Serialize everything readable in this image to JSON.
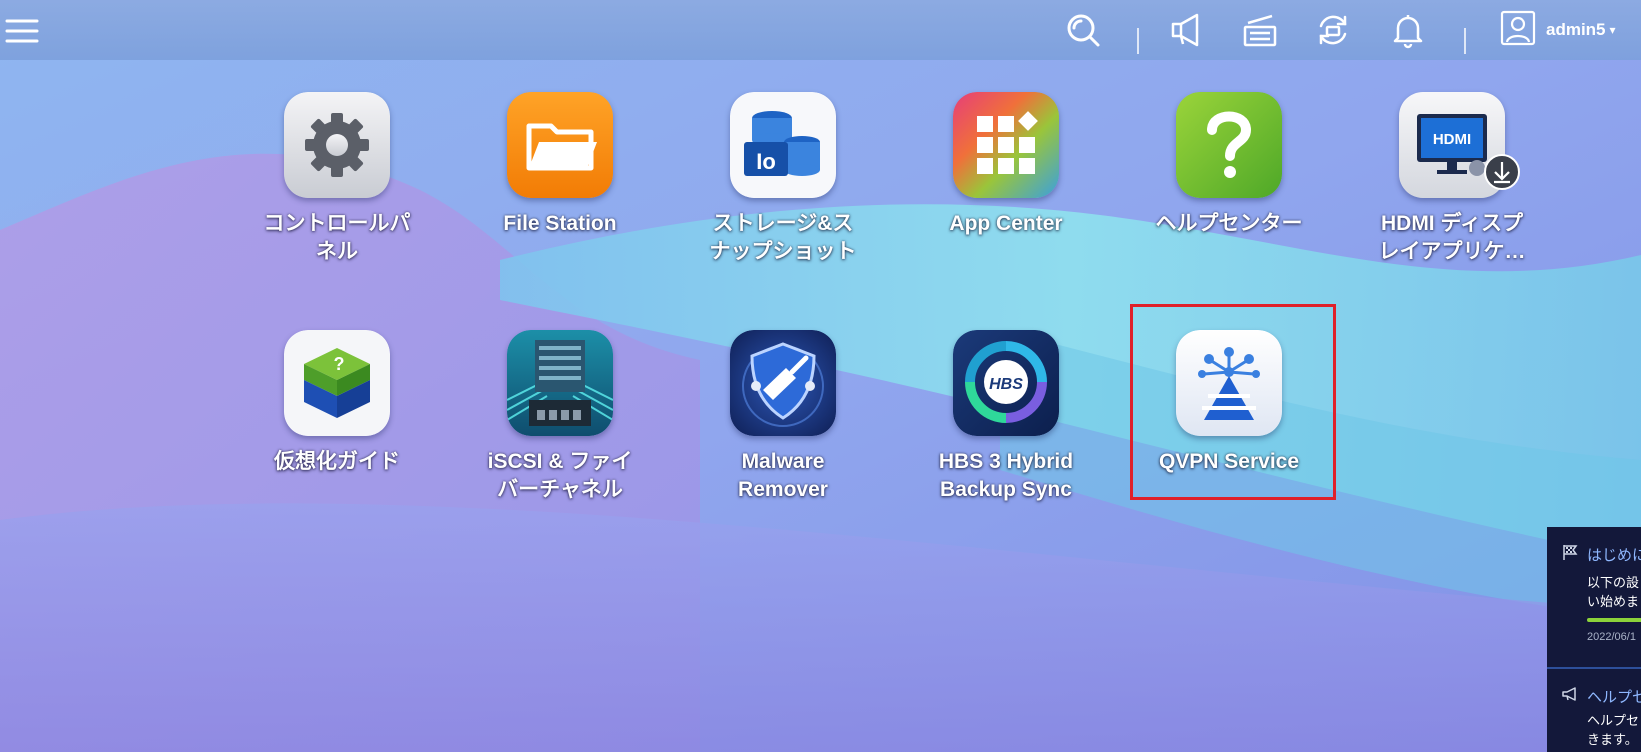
{
  "topbar": {
    "menu_icon": "hamburger-menu-icon",
    "icons": [
      "search-icon",
      "megaphone-icon",
      "task-status-icon",
      "sync-icon",
      "bell-icon"
    ],
    "username": "admin5",
    "caret": "▾"
  },
  "apps": [
    {
      "label": "コントロールパ\nネル",
      "icon": "gear-icon"
    },
    {
      "label": "File Station",
      "icon": "folder-icon"
    },
    {
      "label": "ストレージ&ス\nナップショット",
      "icon": "storage-icon"
    },
    {
      "label": "App Center",
      "icon": "app-grid-icon"
    },
    {
      "label": "ヘルプセンター",
      "icon": "question-icon"
    },
    {
      "label": "HDMI ディスプ\nレイアプリケ…",
      "icon": "hdmi-monitor-icon"
    },
    {
      "label": "仮想化ガイド",
      "icon": "virtualization-cube-icon"
    },
    {
      "label": "iSCSI & ファイ\nバーチャネル",
      "icon": "iscsi-server-icon"
    },
    {
      "label": "Malware\nRemover",
      "icon": "shield-broom-icon"
    },
    {
      "label": "HBS 3 Hybrid\nBackup Sync",
      "icon": "hbs-backup-icon"
    },
    {
      "label": "QVPN Service",
      "icon": "vpn-network-icon"
    }
  ],
  "notifications": [
    {
      "title": "はじめに",
      "body": "以下の設\nい始めま",
      "date": "2022/06/1",
      "icon": "flag-icon",
      "progress_color": "#8cd33a"
    },
    {
      "title": "ヘルプセ",
      "body": "ヘルプセ\nきます。",
      "icon": "megaphone-icon"
    }
  ],
  "colors": {
    "highlight": "#e0202a",
    "panel_bg": "#13183a"
  }
}
